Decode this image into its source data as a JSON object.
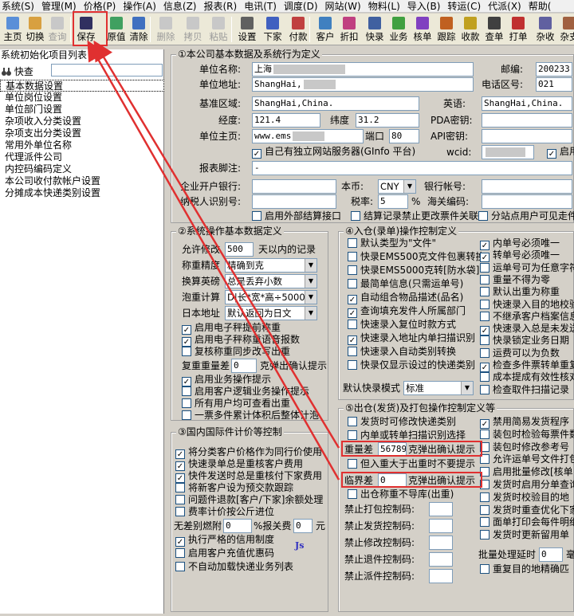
{
  "menu": [
    "系统(S)",
    "管理(M)",
    "价格(P)",
    "操作(A)",
    "信息(Z)",
    "报表(R)",
    "电讯(T)",
    "调度(D)",
    "网站(W)",
    "物料(L)",
    "导入(B)",
    "转运(C)",
    "代派(X)",
    "帮助("
  ],
  "toolbar": [
    {
      "label": "主页",
      "icon": "home-icon",
      "enabled": true,
      "color": "#5a8fd8"
    },
    {
      "label": "切换",
      "icon": "switch-icon",
      "enabled": true,
      "color": "#d8a040"
    },
    {
      "label": "查询",
      "icon": "binoculars-icon",
      "enabled": false,
      "color": "#808080"
    },
    {
      "label": "保存",
      "icon": "save-icon",
      "enabled": true,
      "color": "#303060"
    },
    {
      "label": "原值",
      "icon": "restore-icon",
      "enabled": true,
      "color": "#40a060"
    },
    {
      "label": "清除",
      "icon": "clear-icon",
      "enabled": true,
      "color": "#4070c0"
    },
    {
      "label": "删除",
      "icon": "delete-icon",
      "enabled": false,
      "color": "#808080"
    },
    {
      "label": "拷贝",
      "icon": "copy-icon",
      "enabled": false,
      "color": "#808080"
    },
    {
      "label": "粘贴",
      "icon": "paste-icon",
      "enabled": false,
      "color": "#808080"
    },
    {
      "label": "设置",
      "icon": "settings-icon",
      "enabled": true,
      "color": "#606060"
    },
    {
      "label": "下家",
      "icon": "downstream-icon",
      "enabled": true,
      "color": "#4060c0"
    },
    {
      "label": "付款",
      "icon": "payment-icon",
      "enabled": true,
      "color": "#c04040"
    },
    {
      "label": "客户",
      "icon": "customer-icon",
      "enabled": true,
      "color": "#4080c0"
    },
    {
      "label": "折扣",
      "icon": "discount-icon",
      "enabled": true,
      "color": "#c04080"
    },
    {
      "label": "快录",
      "icon": "quick-entry-icon",
      "enabled": true,
      "color": "#4060a0"
    },
    {
      "label": "业务",
      "icon": "business-icon",
      "enabled": true,
      "color": "#40a040"
    },
    {
      "label": "核单",
      "icon": "verify-icon",
      "enabled": true,
      "color": "#8040c0"
    },
    {
      "label": "跟踪",
      "icon": "track-icon",
      "enabled": true,
      "color": "#c06020"
    },
    {
      "label": "收款",
      "icon": "receive-icon",
      "enabled": true,
      "color": "#c0a020"
    },
    {
      "label": "查单",
      "icon": "search-order-icon",
      "enabled": true,
      "color": "#404040"
    },
    {
      "label": "打单",
      "icon": "print-icon",
      "enabled": true,
      "color": "#c03030"
    },
    {
      "label": "杂收",
      "icon": "misc-income-icon",
      "enabled": true,
      "color": "#6060a0"
    },
    {
      "label": "杂支",
      "icon": "misc-expense-icon",
      "enabled": true,
      "color": "#a06040"
    }
  ],
  "left": {
    "title": "系统初始化项目列表",
    "search_label": "快查",
    "items": [
      "基本数据设置",
      "单位岗位设置",
      "单位部门设置",
      "杂项收入分类设置",
      "杂项支出分类设置",
      "常用外单位名称",
      "代理派件公司",
      "内控码编码定义",
      "本公司收付款帐户设置",
      "分摊成本快递类别设置"
    ]
  },
  "g1": {
    "title": "①本公司基本数据及系统行为定义",
    "name_label": "单位名称:",
    "name_value": "上海",
    "postcode_label": "邮编:",
    "postcode_value": "200233",
    "addr_label": "单位地址:",
    "addr_value": "ShangHai,",
    "area_label": "电话区号:",
    "area_value": "021",
    "region_label": "基准区域:",
    "region_value": "ShangHai,China.",
    "en_label": "英语:",
    "en_value": "ShangHai,China.",
    "lng_label": "经度:",
    "lng_value": "121.4",
    "lat_label": "纬度",
    "lat_value": "31.2",
    "pda_label": "PDA密钥:",
    "home_label": "单位主页:",
    "home_value": "www.ems",
    "port_label": "端口",
    "port_value": "80",
    "api_label": "API密钥:",
    "own_server": "自己有独立网站服务器(GInfo 平台)",
    "wcid_label": "wcid:",
    "enable_label": "启用",
    "footer_label": "报表脚注:",
    "footer_value": "-",
    "bank_label": "企业开户银行:",
    "currency_label": "本币:",
    "currency_value": "CNY",
    "account_label": "银行帐号:",
    "tax_label": "纳税人识别号:",
    "rate_label": "税率:",
    "rate_value": "5",
    "rate_unit": "%",
    "customs_label": "海关编码:",
    "ext_settle": "启用外部结算接口",
    "settle_lock": "结算记录禁止更改票件关联",
    "branch_visible": "分站点用户可见走件"
  },
  "g2": {
    "title": "②系统操作基本数据定义",
    "allow_label": "允许修改",
    "allow_value": "500",
    "allow_suffix": "天以内的记录",
    "precision_label": "称重精度",
    "precision_value": "精确到克",
    "convert_label": "换算英磅",
    "convert_value": "总是丢弃小数",
    "bubble_label": "泡重计算",
    "bubble_value": "D|长*宽*高÷5000",
    "jp_label": "日本地址",
    "jp_value": "默认返回为日文",
    "checks": [
      {
        "label": "启用电子秤提前称重",
        "checked": true
      },
      {
        "label": "启用电子秤称重语音报数",
        "checked": true
      },
      {
        "label": "复核称重同步改写出重",
        "checked": false
      }
    ],
    "reweigh_label": "复重重量差",
    "reweigh_value": "0",
    "reweigh_suffix": "克弹出确认提示",
    "checks2": [
      {
        "label": "启用业务操作提示",
        "checked": true
      },
      {
        "label": "启用客户逻辑业务操作提示",
        "checked": false
      },
      {
        "label": "所有用户均可查看出重",
        "checked": false
      },
      {
        "label": "一票多件累计体积后整体计泡",
        "checked": false
      }
    ]
  },
  "g3": {
    "title": "③国内国际件计价等控制",
    "checks": [
      {
        "label": "将分类客户价格作为同行价使用",
        "checked": true
      },
      {
        "label": "快速录单总是重核客户费用",
        "checked": true
      },
      {
        "label": "快件发送时总是重核付下家费用",
        "checked": true
      },
      {
        "label": "将新客户设为预交款跟踪",
        "checked": false
      },
      {
        "label": "问题件退款[客户/下家]余额处理",
        "checked": false
      },
      {
        "label": "费率计价按公斤进位",
        "checked": false
      }
    ],
    "noprice_label": "无差别燃附",
    "noprice_value": "0",
    "insure_label": "%报关费",
    "insure_value": "0",
    "insure_unit": "元",
    "checks2": [
      {
        "label": "执行严格的信用制度",
        "checked": true
      },
      {
        "label": "启用客户充值优惠码",
        "checked": false
      },
      {
        "label": "不自动加载快递业务列表",
        "checked": false
      }
    ]
  },
  "g4": {
    "title": "④入仓(录单)操作控制定义",
    "left": [
      {
        "label": "默认类型为\"文件\"",
        "checked": false
      },
      {
        "label": "快录EMS500克文件包裹转换",
        "checked": false
      },
      {
        "label": "快录EMS5000克转[防水袋]",
        "checked": false
      },
      {
        "label": "最简单信息(只需运单号)",
        "checked": false
      },
      {
        "label": "自动组合物品描述(品名)",
        "checked": true
      },
      {
        "label": "查询填充发件人所属部门",
        "checked": true
      },
      {
        "label": "快速录入复位时款方式",
        "checked": false
      },
      {
        "label": "快速录入地址内单扫描识别",
        "checked": true
      },
      {
        "label": "快速录入自动类别转换",
        "checked": false
      },
      {
        "label": "快录仅显示设过的快递类别",
        "checked": false
      }
    ],
    "mode_label": "默认快录模式",
    "mode_value": "标准",
    "right": [
      {
        "label": "内单号必须唯一",
        "checked": true
      },
      {
        "label": "转单号必须唯一",
        "checked": true
      },
      {
        "label": "运单号可为任意字符",
        "checked": false
      },
      {
        "label": "重量不得为零",
        "checked": false
      },
      {
        "label": "默认出重为称重",
        "checked": false
      },
      {
        "label": "快速录入目的地校验",
        "checked": false
      },
      {
        "label": "不继承客户档案信息",
        "checked": false
      },
      {
        "label": "快速录入总是未发送",
        "checked": true
      },
      {
        "label": "快录锁定业务日期",
        "checked": false
      },
      {
        "label": "运费可以为负数",
        "checked": false
      },
      {
        "label": "检查多件票转单重复",
        "checked": true
      },
      {
        "label": "成本提成有效性核对",
        "checked": false
      },
      {
        "label": "检查取件扫描记录",
        "checked": false
      }
    ]
  },
  "g5": {
    "title": "⑤出仓(发货)及打包操作控制定义等",
    "left": [
      {
        "label": "发货时可修改快递类别",
        "checked": false
      },
      {
        "label": "内单或转单扫描识别选择",
        "checked": false
      }
    ],
    "weightdiff_label": "重量差",
    "weightdiff_value": "56789",
    "weightdiff_suffix": "克弹出确认提示",
    "heavy_check": "但入重大于出重时不要提示",
    "critical_label": "临界差",
    "critical_value": "0",
    "critical_suffix": "克弹出确认提示",
    "out_check": "出仓称重不导库(出重)",
    "forbid": [
      "禁止打包控制码:",
      "禁止发货控制码:",
      "禁止修改控制码:",
      "禁止退件控制码:",
      "禁止派件控制码:"
    ],
    "right": [
      {
        "label": "禁用简易发货程序",
        "checked": true
      },
      {
        "label": "装包时检验每票件数",
        "checked": false
      },
      {
        "label": "装包时修改参考号",
        "checked": false
      },
      {
        "label": "允许运单号文件打包",
        "checked": false
      },
      {
        "label": "启用批量修改[核单",
        "checked": false
      },
      {
        "label": "发货时启用分单查询",
        "checked": false
      },
      {
        "label": "发货时校验目的地",
        "checked": false
      },
      {
        "label": "发货时重查优化下家",
        "checked": false
      },
      {
        "label": "面单打印会每件明细",
        "checked": false
      },
      {
        "label": "发货时更新留用单",
        "checked": false
      }
    ],
    "batch_label": "批量处理延时",
    "batch_value": "0",
    "batch_unit": "毫",
    "last_check": "重复目的地精确匹"
  }
}
